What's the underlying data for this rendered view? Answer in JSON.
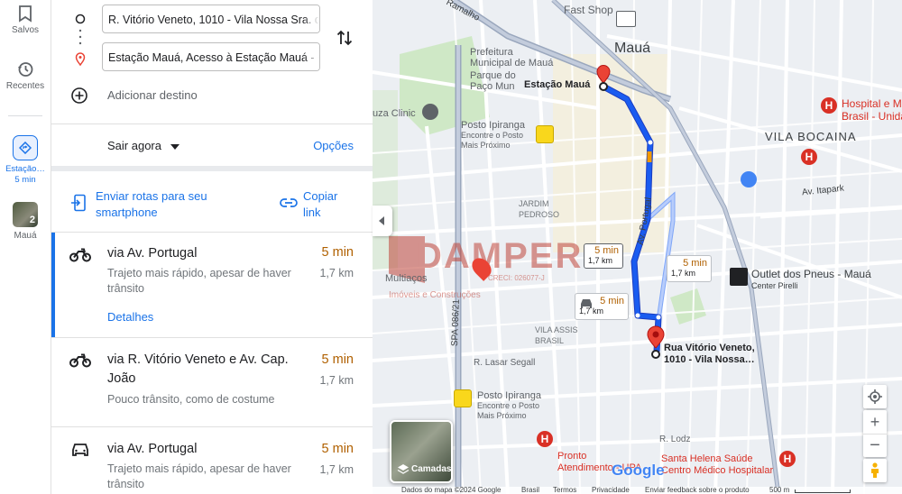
{
  "rail": {
    "saved_label": "Salvos",
    "recents_label": "Recentes",
    "active_label": "Estação…",
    "active_time": "5 min",
    "thumb_label": "Mauá",
    "thumb_count": "2"
  },
  "directions": {
    "origin": "R. Vitório Veneto, 1010 - Vila Nossa Sra. da",
    "destination": "Estação Mauá, Acesso à Estação Mauá - C",
    "add_destination": "Adicionar destino",
    "depart": "Sair agora",
    "options": "Opções",
    "send_label_1": "Enviar rotas para seu",
    "send_label_2": "smartphone",
    "copy_label_1": "Copiar",
    "copy_label_2": "link"
  },
  "routes": [
    {
      "name": "via Av. Portugal",
      "time": "5 min",
      "distance": "1,7 km",
      "desc_1": "Trajeto mais rápido, apesar de haver",
      "desc_2": "trânsito",
      "details": "Detalhes",
      "mode_icon": "motorcycle-icon"
    },
    {
      "name": "via R. Vitório Veneto e Av. Cap. João",
      "time": "5 min",
      "distance": "1,7 km",
      "desc_1": "Pouco trânsito, como de costume",
      "mode_icon": "motorcycle-icon"
    },
    {
      "name": "via Av. Portugal",
      "time": "5 min",
      "distance": "1,7 km",
      "desc_1": "Trajeto mais rápido, apesar de haver",
      "desc_2": "trânsito",
      "mode_icon": "car-icon"
    }
  ],
  "map": {
    "labels": {
      "maua": "Mauá",
      "vila_bocaina": "VILA BOCAINA",
      "estacao_maua": "Estação Mauá",
      "fast_shop": "Fast Shop",
      "prefeitura_1": "Prefeitura",
      "prefeitura_2": "Municipal de Mauá",
      "parque_1": "Parque do",
      "parque_2": "Paço Mun",
      "posto_1": "Posto Ipiranga",
      "posto_2": "Encontre o Posto",
      "posto_3": "Mais Próximo",
      "posto2_1": "Posto Ipiranga",
      "posto2_2": "Encontre o Posto",
      "posto2_3": "Mais Próximo",
      "jardim_pedroso_1": "JARDIM",
      "jardim_pedroso_2": "PEDROSO",
      "vila_assis_1": "VILA ASSIS",
      "vila_assis_2": "BRASIL",
      "r_lasar": "R. Lasar Segall",
      "spa": "SPA 086/21",
      "multiacos": "Multiaços",
      "outlet_1": "Outlet dos Pneus - Mauá",
      "outlet_2": "Center Pirelli",
      "hospital_1": "Hospital e Ma",
      "hospital_2": "Brasil - Unida",
      "av_itapark": "Av. Itapark",
      "av_portugal": "Av. Portugal",
      "destino_1": "Rua Vitório Veneto,",
      "destino_2": "1010 - Vila Nossa…",
      "upa_1": "Pronto",
      "upa_2": "Atendimento - UPA",
      "santa_helena_1": "Santa Helena Saúde",
      "santa_helena_2": "Centro Médico Hospitalar",
      "r_lodz": "R. Lodz",
      "ramalho": "Ramalho",
      "clinic": "uza Clinic",
      "watermark_1": "DAMPER",
      "watermark_2": "Imóveis e Construções",
      "watermark_creci": "CRECI: 026077-J",
      "google": "Google",
      "layers": "Camadas"
    },
    "badges": [
      {
        "time": "5 min",
        "distance": "1,7 km"
      },
      {
        "time": "5 min",
        "distance": "1,7 km"
      },
      {
        "time": "5 min",
        "distance": "1,7 km"
      }
    ],
    "footer": [
      "Dados do mapa ©2024 Google",
      "Brasil",
      "Termos",
      "Privacidade",
      "Enviar feedback sobre o produto",
      "500 m"
    ]
  },
  "colors": {
    "accent": "#1a73e8",
    "route": "#1a5cf0",
    "traffic": "#f29900",
    "pin": "#ea4335"
  }
}
